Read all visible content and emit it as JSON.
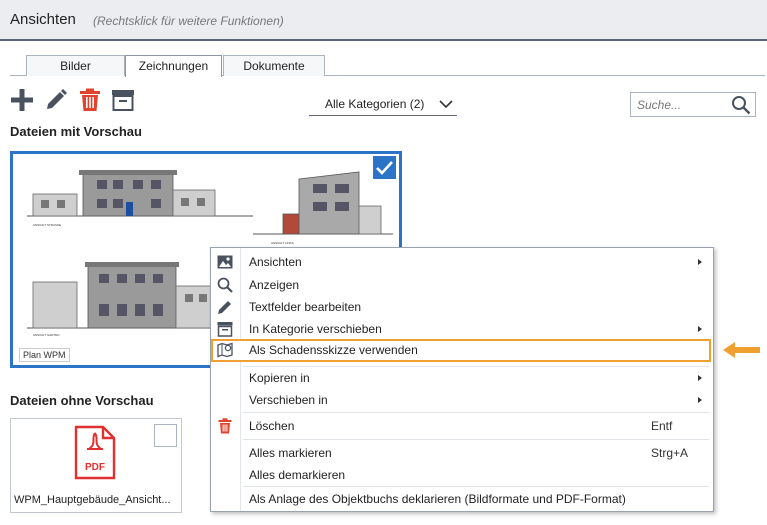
{
  "window": {
    "title": "Ansichten",
    "hint": "(Rechtsklick für weitere Funktionen)"
  },
  "tabs": [
    {
      "label": "Bilder",
      "active": false
    },
    {
      "label": "Zeichnungen",
      "active": true
    },
    {
      "label": "Dokumente",
      "active": false
    }
  ],
  "toolbar": {
    "icons": [
      "plus-icon",
      "pencil-icon",
      "trash-icon",
      "archive-box-icon"
    ]
  },
  "category_filter": {
    "selected": "Alle Kategorien (2)"
  },
  "search": {
    "placeholder": "Suche..."
  },
  "sections": {
    "with_preview": "Dateien mit Vorschau",
    "without_preview": "Dateien ohne Vorschau"
  },
  "preview_file": {
    "caption": "Plan WPM",
    "selected": true
  },
  "pdf_file": {
    "badge": "PDF",
    "name": "WPM_Hauptgebäude_Ansicht...",
    "selected": false
  },
  "context_menu": {
    "items": [
      {
        "label": "Ansichten",
        "icon": "image-icon",
        "submenu": true
      },
      {
        "label": "Anzeigen",
        "icon": "magnifier-icon",
        "submenu": false
      },
      {
        "label": "Textfelder bearbeiten",
        "icon": "pencil-icon",
        "submenu": false
      },
      {
        "label": "In Kategorie verschieben",
        "icon": "archive-box-icon",
        "submenu": true
      },
      {
        "label": "Als Schadensskizze verwenden",
        "icon": "map-pin-icon",
        "submenu": false,
        "highlighted": true
      },
      {
        "label": "Kopieren in",
        "submenu": true
      },
      {
        "label": "Verschieben in",
        "submenu": true
      },
      {
        "label": "Löschen",
        "icon": "trash-icon",
        "shortcut": "Entf"
      },
      {
        "label": "Alles markieren",
        "shortcut": "Strg+A"
      },
      {
        "label": "Alles demarkieren"
      },
      {
        "label": "Als Anlage des Objektbuchs deklarieren (Bildformate und PDF-Format)"
      }
    ]
  },
  "colors": {
    "accent_blue": "#2b74c7",
    "delete_red": "#e0442e",
    "highlight_orange": "#f0a030",
    "pdf_red": "#e03030",
    "icon_gray": "#4a5260"
  }
}
